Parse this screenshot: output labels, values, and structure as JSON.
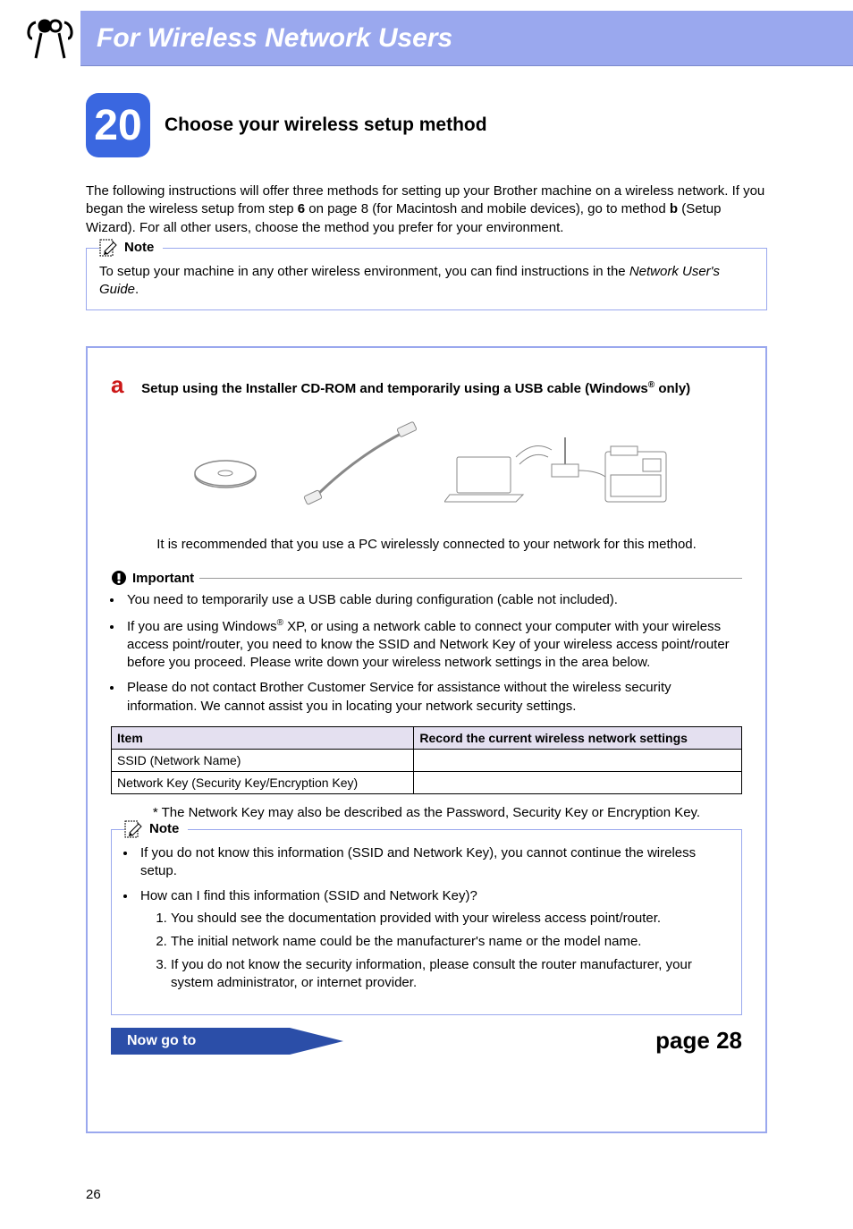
{
  "banner": {
    "title": "For Wireless Network Users"
  },
  "step": {
    "number": "20",
    "title": "Choose your wireless setup method"
  },
  "intro": {
    "p1_a": "The following instructions will offer three methods for setting up your Brother machine on a wireless network. If you began the wireless setup from step ",
    "p1_bold1": "6",
    "p1_b": " on page 8 (for Macintosh and mobile devices), go to method ",
    "p1_bold2": "b",
    "p1_c": " (Setup Wizard). For all other users, choose the method you prefer for your environment."
  },
  "note1": {
    "label": "Note",
    "text_a": "To setup your machine in any other wireless environment, you can find instructions in the ",
    "text_em": "Network User's Guide",
    "text_b": "."
  },
  "method_a": {
    "letter": "a",
    "title_a": "Setup using the Installer CD-ROM and temporarily using a USB cable (Windows",
    "title_reg": "®",
    "title_b": " only)",
    "recommend": "It is recommended that you use a PC wirelessly connected to your network for this method.",
    "important_label": "Important",
    "bullets": {
      "b1": "You need to temporarily use a USB cable during configuration (cable not included).",
      "b2_a": "If you are using Windows",
      "b2_reg": "®",
      "b2_b": " XP, or using a network cable to connect your computer with your wireless access point/router, you need to know the SSID and Network Key of your wireless access point/router before you proceed. Please write down your wireless network settings in the area below.",
      "b3": "Please do not contact Brother Customer Service for assistance without the wireless security information. We cannot assist you in locating your network security settings."
    },
    "table": {
      "h1": "Item",
      "h2": "Record the current wireless network settings",
      "r1": "SSID (Network Name)",
      "r2": "Network Key (Security Key/Encryption Key)"
    },
    "footnote": "*   The Network Key may also be described as the Password, Security Key or Encryption Key.",
    "note2": {
      "label": "Note",
      "b1": "If you do not know this information (SSID and Network Key), you cannot continue the wireless setup.",
      "b2": "How can I find this information (SSID and Network Key)?",
      "n1": "You should see the documentation provided with your wireless access point/router.",
      "n2": "The initial network name could be the manufacturer's name or the model name.",
      "n3": "If you do not know the security information, please consult the router manufacturer, your system administrator, or internet provider."
    },
    "goto_label": "Now go to",
    "goto_page": "page 28"
  },
  "page_number": "26"
}
